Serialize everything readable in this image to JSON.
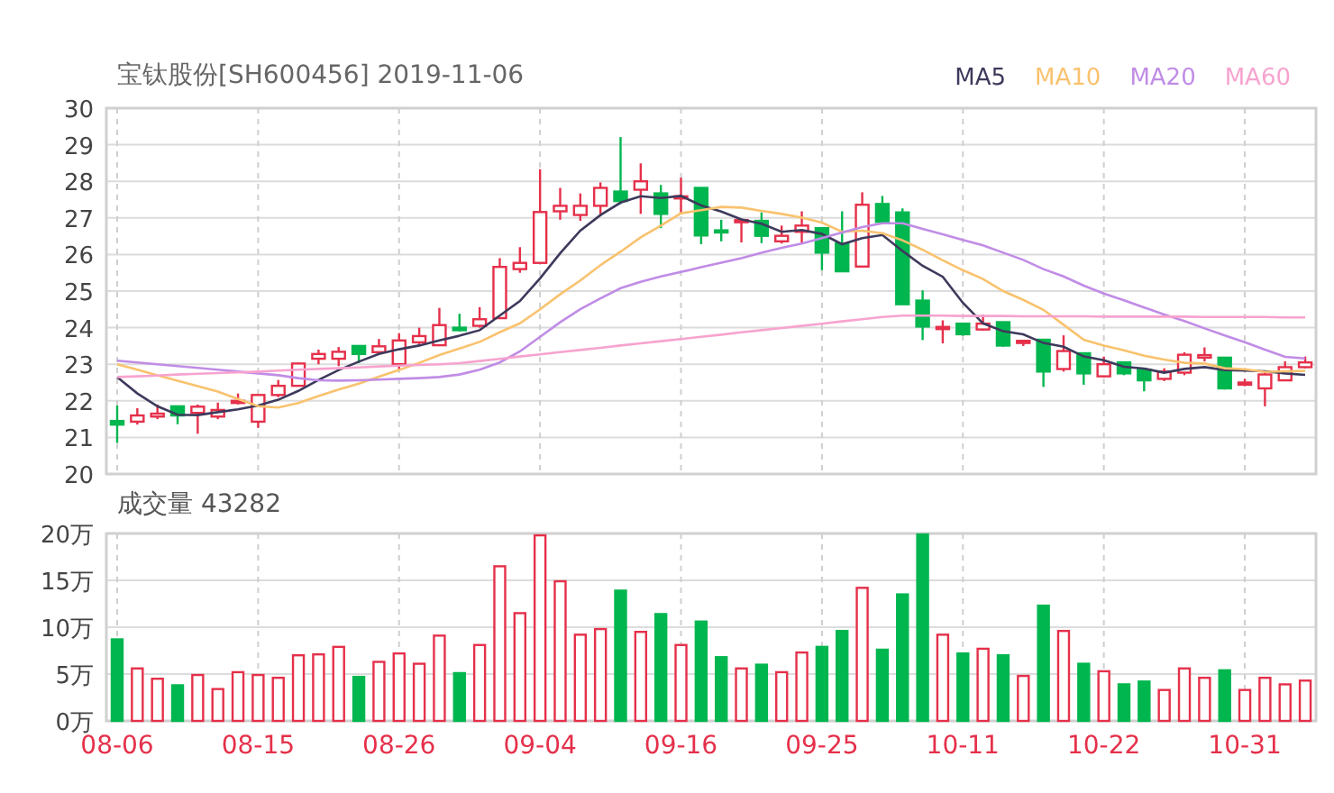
{
  "header": {
    "title": "宝钛股份[SH600456] 2019-11-06"
  },
  "price_chart": {
    "chart_data": {
      "type": "candlestick",
      "grid": true,
      "ylim": [
        20,
        30
      ],
      "yticks": [
        20,
        21,
        22,
        23,
        24,
        25,
        26,
        27,
        28,
        29,
        30
      ],
      "categories": [
        null,
        null,
        null,
        null,
        null,
        null,
        null,
        null,
        null,
        null,
        null,
        null,
        null,
        null,
        null,
        null,
        null,
        null,
        null,
        null,
        null,
        null,
        null,
        null,
        null,
        null,
        null,
        null,
        null,
        null,
        null,
        null,
        null,
        null,
        null,
        null,
        null,
        null,
        null,
        null,
        null,
        null,
        null,
        null,
        null,
        null,
        null,
        null,
        null,
        null,
        null,
        null,
        null,
        null,
        null,
        null,
        null,
        null,
        null,
        null
      ],
      "ohlc": [
        [
          21.45,
          21.87,
          20.85,
          21.35
        ],
        [
          21.43,
          21.8,
          21.35,
          21.6
        ],
        [
          21.57,
          21.9,
          21.5,
          21.65
        ],
        [
          21.85,
          21.87,
          21.36,
          21.6
        ],
        [
          21.67,
          21.9,
          21.1,
          21.84
        ],
        [
          21.57,
          21.95,
          21.5,
          21.75
        ],
        [
          21.95,
          22.2,
          21.9,
          22.0
        ],
        [
          21.43,
          22.16,
          21.26,
          22.16
        ],
        [
          22.16,
          22.57,
          22.1,
          22.41
        ],
        [
          22.41,
          23.02,
          22.41,
          23.02
        ],
        [
          23.15,
          23.4,
          23.0,
          23.28
        ],
        [
          23.15,
          23.47,
          22.95,
          23.34
        ],
        [
          23.5,
          23.5,
          23.03,
          23.28
        ],
        [
          23.33,
          23.69,
          23.28,
          23.49
        ],
        [
          23.0,
          23.85,
          22.85,
          23.65
        ],
        [
          23.6,
          24.0,
          23.52,
          23.77
        ],
        [
          23.52,
          24.54,
          23.52,
          24.07
        ],
        [
          24.0,
          24.38,
          23.9,
          23.93
        ],
        [
          24.05,
          24.56,
          24.0,
          24.23
        ],
        [
          24.26,
          25.9,
          24.26,
          25.66
        ],
        [
          25.6,
          26.2,
          25.5,
          25.77
        ],
        [
          25.77,
          28.33,
          25.77,
          27.16
        ],
        [
          27.18,
          27.82,
          26.95,
          27.33
        ],
        [
          27.08,
          27.67,
          26.92,
          27.33
        ],
        [
          27.33,
          27.97,
          27.05,
          27.82
        ],
        [
          27.72,
          29.21,
          27.38,
          27.46
        ],
        [
          27.77,
          28.49,
          27.11,
          28.0
        ],
        [
          27.67,
          27.9,
          26.72,
          27.11
        ],
        [
          27.55,
          28.1,
          27.1,
          27.59
        ],
        [
          27.82,
          27.82,
          26.28,
          26.52
        ],
        [
          26.66,
          26.95,
          26.36,
          26.62
        ],
        [
          26.9,
          26.94,
          26.33,
          26.94
        ],
        [
          26.92,
          27.15,
          26.31,
          26.51
        ],
        [
          26.36,
          26.79,
          26.3,
          26.51
        ],
        [
          26.62,
          27.18,
          26.28,
          26.79
        ],
        [
          26.72,
          26.72,
          25.57,
          26.05
        ],
        [
          26.3,
          27.18,
          25.54,
          25.54
        ],
        [
          25.67,
          27.7,
          25.67,
          27.36
        ],
        [
          27.38,
          27.6,
          26.89,
          26.89
        ],
        [
          27.15,
          27.26,
          24.64,
          24.64
        ],
        [
          24.74,
          25.02,
          23.66,
          24.03
        ],
        [
          23.98,
          24.2,
          23.57,
          24.02
        ],
        [
          24.11,
          24.11,
          23.78,
          23.82
        ],
        [
          23.95,
          24.36,
          23.92,
          24.11
        ],
        [
          24.15,
          24.15,
          23.48,
          23.51
        ],
        [
          23.6,
          23.67,
          23.5,
          23.64
        ],
        [
          23.67,
          23.67,
          22.38,
          22.8
        ],
        [
          22.87,
          23.79,
          22.8,
          23.36
        ],
        [
          23.3,
          23.3,
          22.44,
          22.75
        ],
        [
          22.67,
          23.21,
          22.64,
          23.0
        ],
        [
          23.05,
          23.08,
          22.7,
          22.75
        ],
        [
          22.85,
          22.88,
          22.26,
          22.56
        ],
        [
          22.6,
          22.89,
          22.54,
          22.8
        ],
        [
          22.77,
          23.33,
          22.7,
          23.26
        ],
        [
          23.18,
          23.46,
          23.08,
          23.25
        ],
        [
          23.18,
          23.18,
          22.31,
          22.34
        ],
        [
          22.46,
          22.6,
          22.4,
          22.5
        ],
        [
          22.34,
          22.8,
          21.85,
          22.72
        ],
        [
          22.56,
          23.08,
          22.56,
          22.92
        ],
        [
          22.92,
          23.21,
          22.89,
          23.05
        ]
      ]
    }
  },
  "moving_averages": {
    "chart_data": {
      "type": "line",
      "ylim": [
        20,
        30
      ],
      "categories": [
        null,
        null,
        null,
        null,
        null,
        null,
        null,
        null,
        null,
        null,
        null,
        null,
        null,
        null,
        null,
        null,
        null,
        null,
        null,
        null,
        null,
        null,
        null,
        null,
        null,
        null,
        null,
        null,
        null,
        null,
        null,
        null,
        null,
        null,
        null,
        null,
        null,
        null,
        null,
        null,
        null,
        null,
        null,
        null,
        null,
        null,
        null,
        null,
        null,
        null,
        null,
        null,
        null,
        null,
        null,
        null,
        null,
        null,
        null,
        null
      ],
      "series": [
        {
          "name": "MA5",
          "color": "#3d3a5c",
          "values": [
            22.65,
            22.2,
            21.85,
            21.62,
            21.61,
            21.69,
            21.77,
            21.87,
            22.03,
            22.27,
            22.57,
            22.84,
            23.07,
            23.28,
            23.41,
            23.51,
            23.65,
            23.78,
            23.93,
            24.33,
            24.73,
            25.35,
            26.03,
            26.65,
            27.08,
            27.42,
            27.59,
            27.54,
            27.6,
            27.34,
            27.17,
            26.96,
            26.84,
            26.62,
            26.67,
            26.56,
            26.28,
            26.45,
            26.53,
            26.1,
            25.69,
            25.39,
            24.68,
            24.12,
            23.9,
            23.82,
            23.58,
            23.48,
            23.21,
            23.11,
            22.93,
            22.88,
            22.77,
            22.87,
            22.92,
            22.84,
            22.83,
            22.81,
            22.75,
            22.71
          ]
        },
        {
          "name": "MA10",
          "color": "#f9c26e",
          "values": [
            23.0,
            22.85,
            22.7,
            22.55,
            22.4,
            22.25,
            22.05,
            21.85,
            21.82,
            21.94,
            22.13,
            22.31,
            22.47,
            22.66,
            22.84,
            23.04,
            23.25,
            23.43,
            23.61,
            23.87,
            24.12,
            24.5,
            24.91,
            25.29,
            25.71,
            26.08,
            26.47,
            26.79,
            27.13,
            27.21,
            27.3,
            27.28,
            27.19,
            27.11,
            27.01,
            26.87,
            26.62,
            26.65,
            26.58,
            26.39,
            26.13,
            25.84,
            25.57,
            25.33,
            25.0,
            24.76,
            24.49,
            24.08,
            23.67,
            23.51,
            23.38,
            23.23,
            23.13,
            23.04,
            23.02,
            22.89,
            22.86,
            22.79,
            22.81,
            22.82
          ]
        },
        {
          "name": "MA20",
          "color": "#c08ce6",
          "values": [
            23.1,
            23.05,
            23.0,
            22.95,
            22.9,
            22.85,
            22.8,
            22.75,
            22.7,
            22.62,
            22.56,
            22.55,
            22.56,
            22.58,
            22.6,
            22.62,
            22.65,
            22.72,
            22.85,
            23.05,
            23.35,
            23.75,
            24.15,
            24.5,
            24.8,
            25.08,
            25.25,
            25.4,
            25.52,
            25.65,
            25.78,
            25.9,
            26.05,
            26.18,
            26.3,
            26.45,
            26.6,
            26.75,
            26.85,
            26.85,
            26.7,
            26.55,
            26.4,
            26.25,
            26.05,
            25.85,
            25.6,
            25.4,
            25.15,
            24.93,
            24.75,
            24.55,
            24.36,
            24.18,
            23.98,
            23.79,
            23.6,
            23.4,
            23.2,
            23.16
          ]
        },
        {
          "name": "MA60",
          "color": "#f7a3cf",
          "values": [
            22.65,
            22.67,
            22.69,
            22.72,
            22.74,
            22.76,
            22.78,
            22.8,
            22.83,
            22.85,
            22.87,
            22.89,
            22.91,
            22.94,
            22.96,
            22.98,
            23.0,
            23.03,
            23.09,
            23.15,
            23.21,
            23.27,
            23.33,
            23.39,
            23.45,
            23.51,
            23.57,
            23.63,
            23.69,
            23.75,
            23.81,
            23.87,
            23.93,
            23.99,
            24.05,
            24.11,
            24.17,
            24.23,
            24.29,
            24.33,
            24.33,
            24.33,
            24.32,
            24.32,
            24.32,
            24.31,
            24.31,
            24.31,
            24.31,
            24.3,
            24.3,
            24.3,
            24.3,
            24.3,
            24.29,
            24.29,
            24.29,
            24.29,
            24.28,
            24.28
          ]
        }
      ]
    }
  },
  "volume_chart": {
    "chart_data": {
      "type": "bar",
      "title": "成交量 43282",
      "grid": true,
      "ylim": [
        0,
        20
      ],
      "yticks": [
        {
          "value": 0,
          "label": "0万"
        },
        {
          "value": 5,
          "label": "5万"
        },
        {
          "value": 10,
          "label": "10万"
        },
        {
          "value": 15,
          "label": "15万"
        },
        {
          "value": 20,
          "label": "20万"
        }
      ],
      "categories": [
        "08-06",
        null,
        null,
        null,
        null,
        null,
        null,
        "08-15",
        null,
        null,
        null,
        null,
        null,
        null,
        "08-26",
        null,
        null,
        null,
        null,
        null,
        null,
        "09-04",
        null,
        null,
        null,
        null,
        null,
        null,
        "09-16",
        null,
        null,
        null,
        null,
        null,
        null,
        "09-25",
        null,
        null,
        null,
        null,
        null,
        null,
        "10-11",
        null,
        null,
        null,
        null,
        null,
        null,
        "10-22",
        null,
        null,
        null,
        null,
        null,
        null,
        "10-31",
        null,
        null,
        null
      ],
      "values": [
        8.7,
        5.6,
        4.5,
        3.8,
        4.9,
        3.4,
        5.2,
        4.9,
        4.6,
        7.0,
        7.1,
        7.9,
        4.7,
        6.3,
        7.2,
        6.1,
        9.1,
        5.1,
        8.1,
        16.5,
        11.5,
        19.8,
        14.9,
        9.2,
        9.8,
        13.9,
        9.5,
        11.4,
        8.1,
        10.6,
        6.8,
        5.6,
        6.0,
        5.2,
        7.3,
        7.9,
        9.6,
        14.2,
        7.6,
        13.5,
        19.9,
        9.2,
        7.2,
        7.7,
        7.0,
        4.8,
        12.3,
        9.6,
        6.1,
        5.3,
        3.9,
        4.2,
        3.3,
        5.6,
        4.6,
        5.4,
        3.3,
        4.6,
        3.9,
        4.3
      ]
    }
  }
}
